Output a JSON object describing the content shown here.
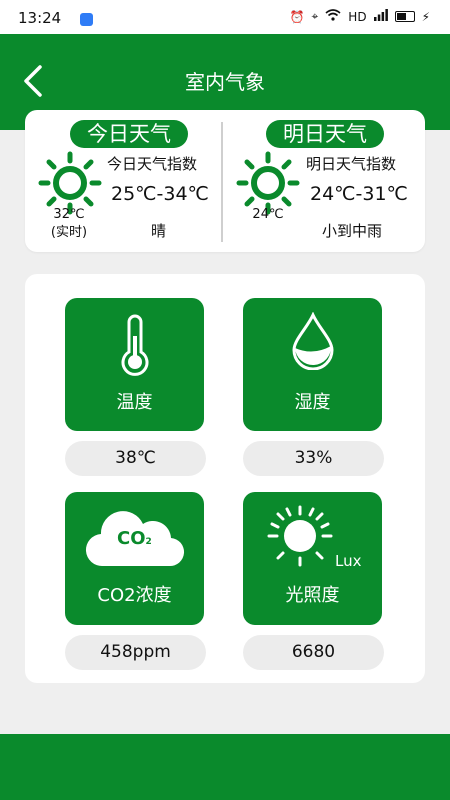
{
  "status_bar": {
    "time": "13:24",
    "network": "HD"
  },
  "header": {
    "title": "室内气象"
  },
  "today": {
    "badge": "今日天气",
    "index_label": "今日天气指数",
    "current_temp": "32℃",
    "current_note": "(实时)",
    "range": "25℃-34℃",
    "condition": "晴"
  },
  "tomorrow": {
    "badge": "明日天气",
    "index_label": "明日天气指数",
    "current_temp": "24℃",
    "range": "24℃-31℃",
    "condition": "小到中雨"
  },
  "sensors": {
    "temperature": {
      "label": "温度",
      "value": "38℃",
      "icon": "thermometer-icon"
    },
    "humidity": {
      "label": "湿度",
      "value": "33%",
      "icon": "water-drop-icon"
    },
    "co2": {
      "label": "CO2浓度",
      "value": "458ppm",
      "icon": "co2-cloud-icon",
      "icon_text": "CO",
      "icon_sub": "2"
    },
    "light": {
      "label": "光照度",
      "value": "6680",
      "icon": "sun-lux-icon",
      "icon_text": "Lux"
    }
  },
  "colors": {
    "primary": "#0a8a2c",
    "background": "#efefef"
  }
}
